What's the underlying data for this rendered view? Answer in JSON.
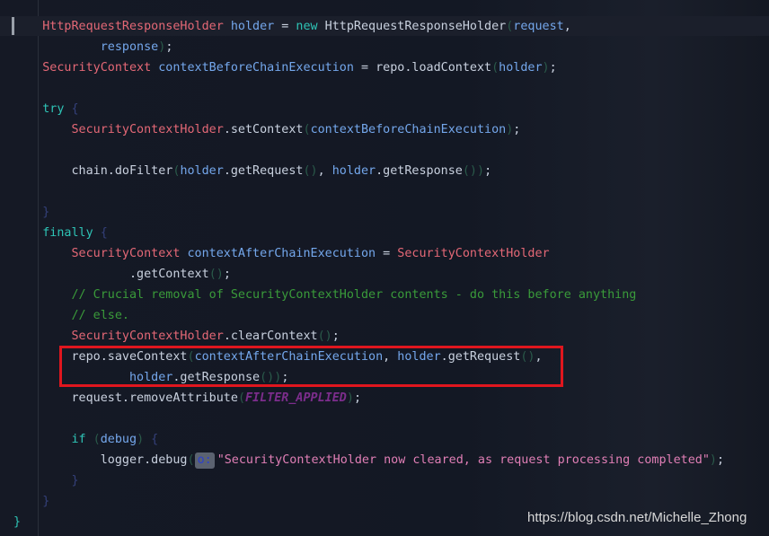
{
  "code_lines": [
    [
      [
        "    ",
        ""
      ],
      [
        "HttpRequestResponseHolder",
        "t"
      ],
      [
        " holder",
        "v"
      ],
      [
        " = ",
        "x"
      ],
      [
        "new",
        "k"
      ],
      [
        " HttpRequestResponseHolder",
        "m"
      ],
      [
        "(",
        "p"
      ],
      [
        "request",
        "v"
      ],
      [
        ",",
        "x"
      ]
    ],
    [
      [
        "            ",
        ""
      ],
      [
        "response",
        "v"
      ],
      [
        ")",
        "p"
      ],
      [
        ";",
        "x"
      ]
    ],
    [
      [
        "    ",
        ""
      ],
      [
        "SecurityContext",
        "t"
      ],
      [
        " contextBeforeChainExecution",
        "v"
      ],
      [
        " = repo.loadContext",
        "m"
      ],
      [
        "(",
        "p"
      ],
      [
        "holder",
        "v"
      ],
      [
        ")",
        "p"
      ],
      [
        ";",
        "x"
      ]
    ],
    [],
    [
      [
        "    ",
        ""
      ],
      [
        "try",
        "k"
      ],
      [
        " {",
        "b"
      ]
    ],
    [
      [
        "        ",
        ""
      ],
      [
        "SecurityContextHolder",
        "t"
      ],
      [
        ".setContext",
        "m"
      ],
      [
        "(",
        "p"
      ],
      [
        "contextBeforeChainExecution",
        "v"
      ],
      [
        ")",
        "p"
      ],
      [
        ";",
        "x"
      ]
    ],
    [],
    [
      [
        "        ",
        ""
      ],
      [
        "chain.doFilter",
        "m"
      ],
      [
        "(",
        "p"
      ],
      [
        "holder",
        "v"
      ],
      [
        ".getRequest",
        "m"
      ],
      [
        "()",
        "p"
      ],
      [
        ", ",
        "x"
      ],
      [
        "holder",
        "v"
      ],
      [
        ".getResponse",
        "m"
      ],
      [
        "())",
        "p"
      ],
      [
        ";",
        "x"
      ]
    ],
    [],
    [
      [
        "    ",
        ""
      ],
      [
        "}",
        "b"
      ]
    ],
    [
      [
        "    ",
        ""
      ],
      [
        "finally",
        "k"
      ],
      [
        " {",
        "b"
      ]
    ],
    [
      [
        "        ",
        ""
      ],
      [
        "SecurityContext",
        "t"
      ],
      [
        " contextAfterChainExecution",
        "v"
      ],
      [
        " = ",
        "x"
      ],
      [
        "SecurityContextHolder",
        "t"
      ]
    ],
    [
      [
        "                ",
        ""
      ],
      [
        ".getContext",
        "m"
      ],
      [
        "()",
        "p"
      ],
      [
        ";",
        "x"
      ]
    ],
    [
      [
        "        ",
        ""
      ],
      [
        "// Crucial removal of SecurityContextHolder contents - do this before anything",
        "c"
      ]
    ],
    [
      [
        "        ",
        ""
      ],
      [
        "// else.",
        "c"
      ]
    ],
    [
      [
        "        ",
        ""
      ],
      [
        "SecurityContextHolder",
        "t"
      ],
      [
        ".clearContext",
        "m"
      ],
      [
        "()",
        "p"
      ],
      [
        ";",
        "x"
      ]
    ],
    [
      [
        "        ",
        ""
      ],
      [
        "repo.saveContext",
        "m"
      ],
      [
        "(",
        "p"
      ],
      [
        "contextAfterChainExecution",
        "v"
      ],
      [
        ", ",
        "x"
      ],
      [
        "holder",
        "v"
      ],
      [
        ".getRequest",
        "m"
      ],
      [
        "()",
        "p"
      ],
      [
        ",",
        "x"
      ]
    ],
    [
      [
        "                ",
        ""
      ],
      [
        "holder",
        "v"
      ],
      [
        ".getResponse",
        "m"
      ],
      [
        "())",
        "p"
      ],
      [
        ";",
        "x"
      ]
    ],
    [
      [
        "        ",
        ""
      ],
      [
        "request.removeAttribute",
        "m"
      ],
      [
        "(",
        "p"
      ],
      [
        "FILTER_APPLIED",
        "cn"
      ],
      [
        ")",
        "p"
      ],
      [
        ";",
        "x"
      ]
    ],
    [],
    [
      [
        "        ",
        ""
      ],
      [
        "if",
        "k"
      ],
      [
        " (",
        "p"
      ],
      [
        "debug",
        "v"
      ],
      [
        ")",
        "p"
      ],
      [
        " {",
        "b"
      ]
    ],
    [
      [
        "            ",
        ""
      ],
      [
        "logger.debug",
        "m"
      ],
      [
        "(",
        "p"
      ],
      [
        "o:",
        "hint"
      ],
      [
        "\"SecurityContextHolder now cleared, as request processing completed\"",
        "s"
      ],
      [
        ")",
        "p"
      ],
      [
        ";",
        "x"
      ]
    ],
    [
      [
        "        ",
        ""
      ],
      [
        "}",
        "b"
      ]
    ],
    [
      [
        "    ",
        ""
      ],
      [
        "}",
        "b"
      ]
    ],
    [
      [
        "",
        ""
      ],
      [
        "}",
        "k"
      ]
    ]
  ],
  "highlight_color": "#e0161e",
  "watermark": "https://blog.csdn.net/Michelle_Zhong"
}
